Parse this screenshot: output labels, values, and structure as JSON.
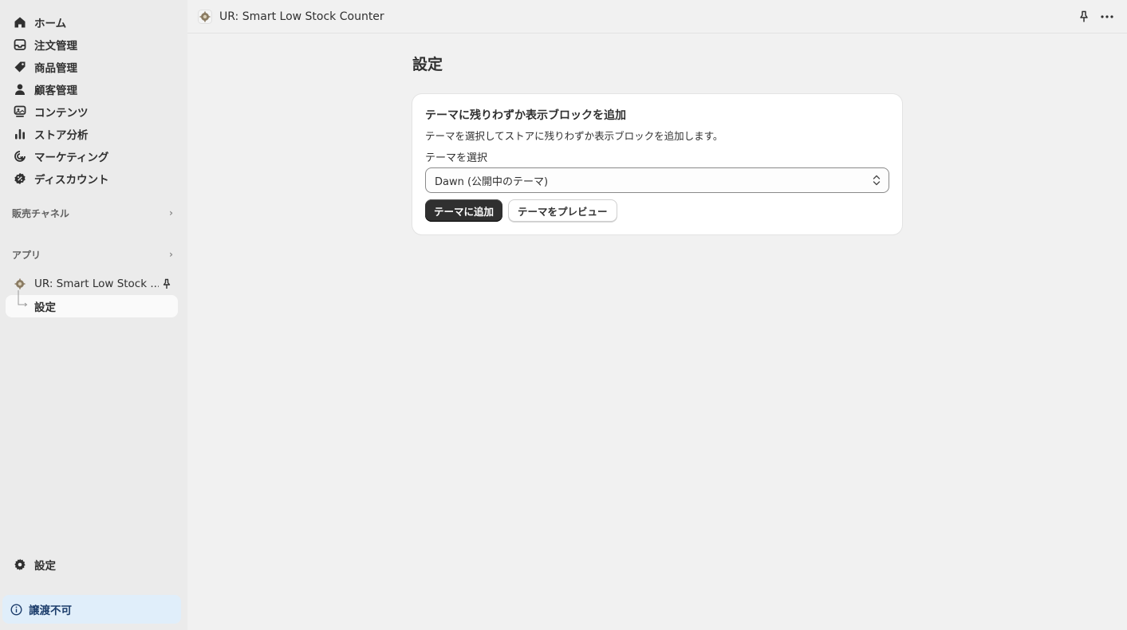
{
  "sidebar": {
    "nav": [
      {
        "label": "ホーム",
        "icon": "home-icon"
      },
      {
        "label": "注文管理",
        "icon": "inbox-icon"
      },
      {
        "label": "商品管理",
        "icon": "tag-icon"
      },
      {
        "label": "顧客管理",
        "icon": "person-icon"
      },
      {
        "label": "コンテンツ",
        "icon": "content-icon"
      },
      {
        "label": "ストア分析",
        "icon": "bar-chart-icon"
      },
      {
        "label": "マーケティング",
        "icon": "target-icon"
      },
      {
        "label": "ディスカウント",
        "icon": "discount-icon"
      }
    ],
    "sales_channels": "販売チャネル",
    "apps": "アプリ",
    "app_item": "UR: Smart Low Stock ...",
    "app_sub_item": "設定",
    "settings": "設定",
    "status": "譲渡不可"
  },
  "topbar": {
    "title": "UR: Smart Low Stock Counter"
  },
  "main": {
    "page_title": "設定",
    "card": {
      "title": "テーマに残りわずか表示ブロックを追加",
      "description": "テーマを選択してストアに残りわずか表示ブロックを追加します。",
      "field_label": "テーマを選択",
      "selected_theme": "Dawn (公開中のテーマ)",
      "add_button": "テーマに追加",
      "preview_button": "テーマをプレビュー"
    }
  },
  "colors": {
    "primary_button": "#303030",
    "status_bg": "#e0eefa",
    "page_bg": "#f1f1f1"
  }
}
